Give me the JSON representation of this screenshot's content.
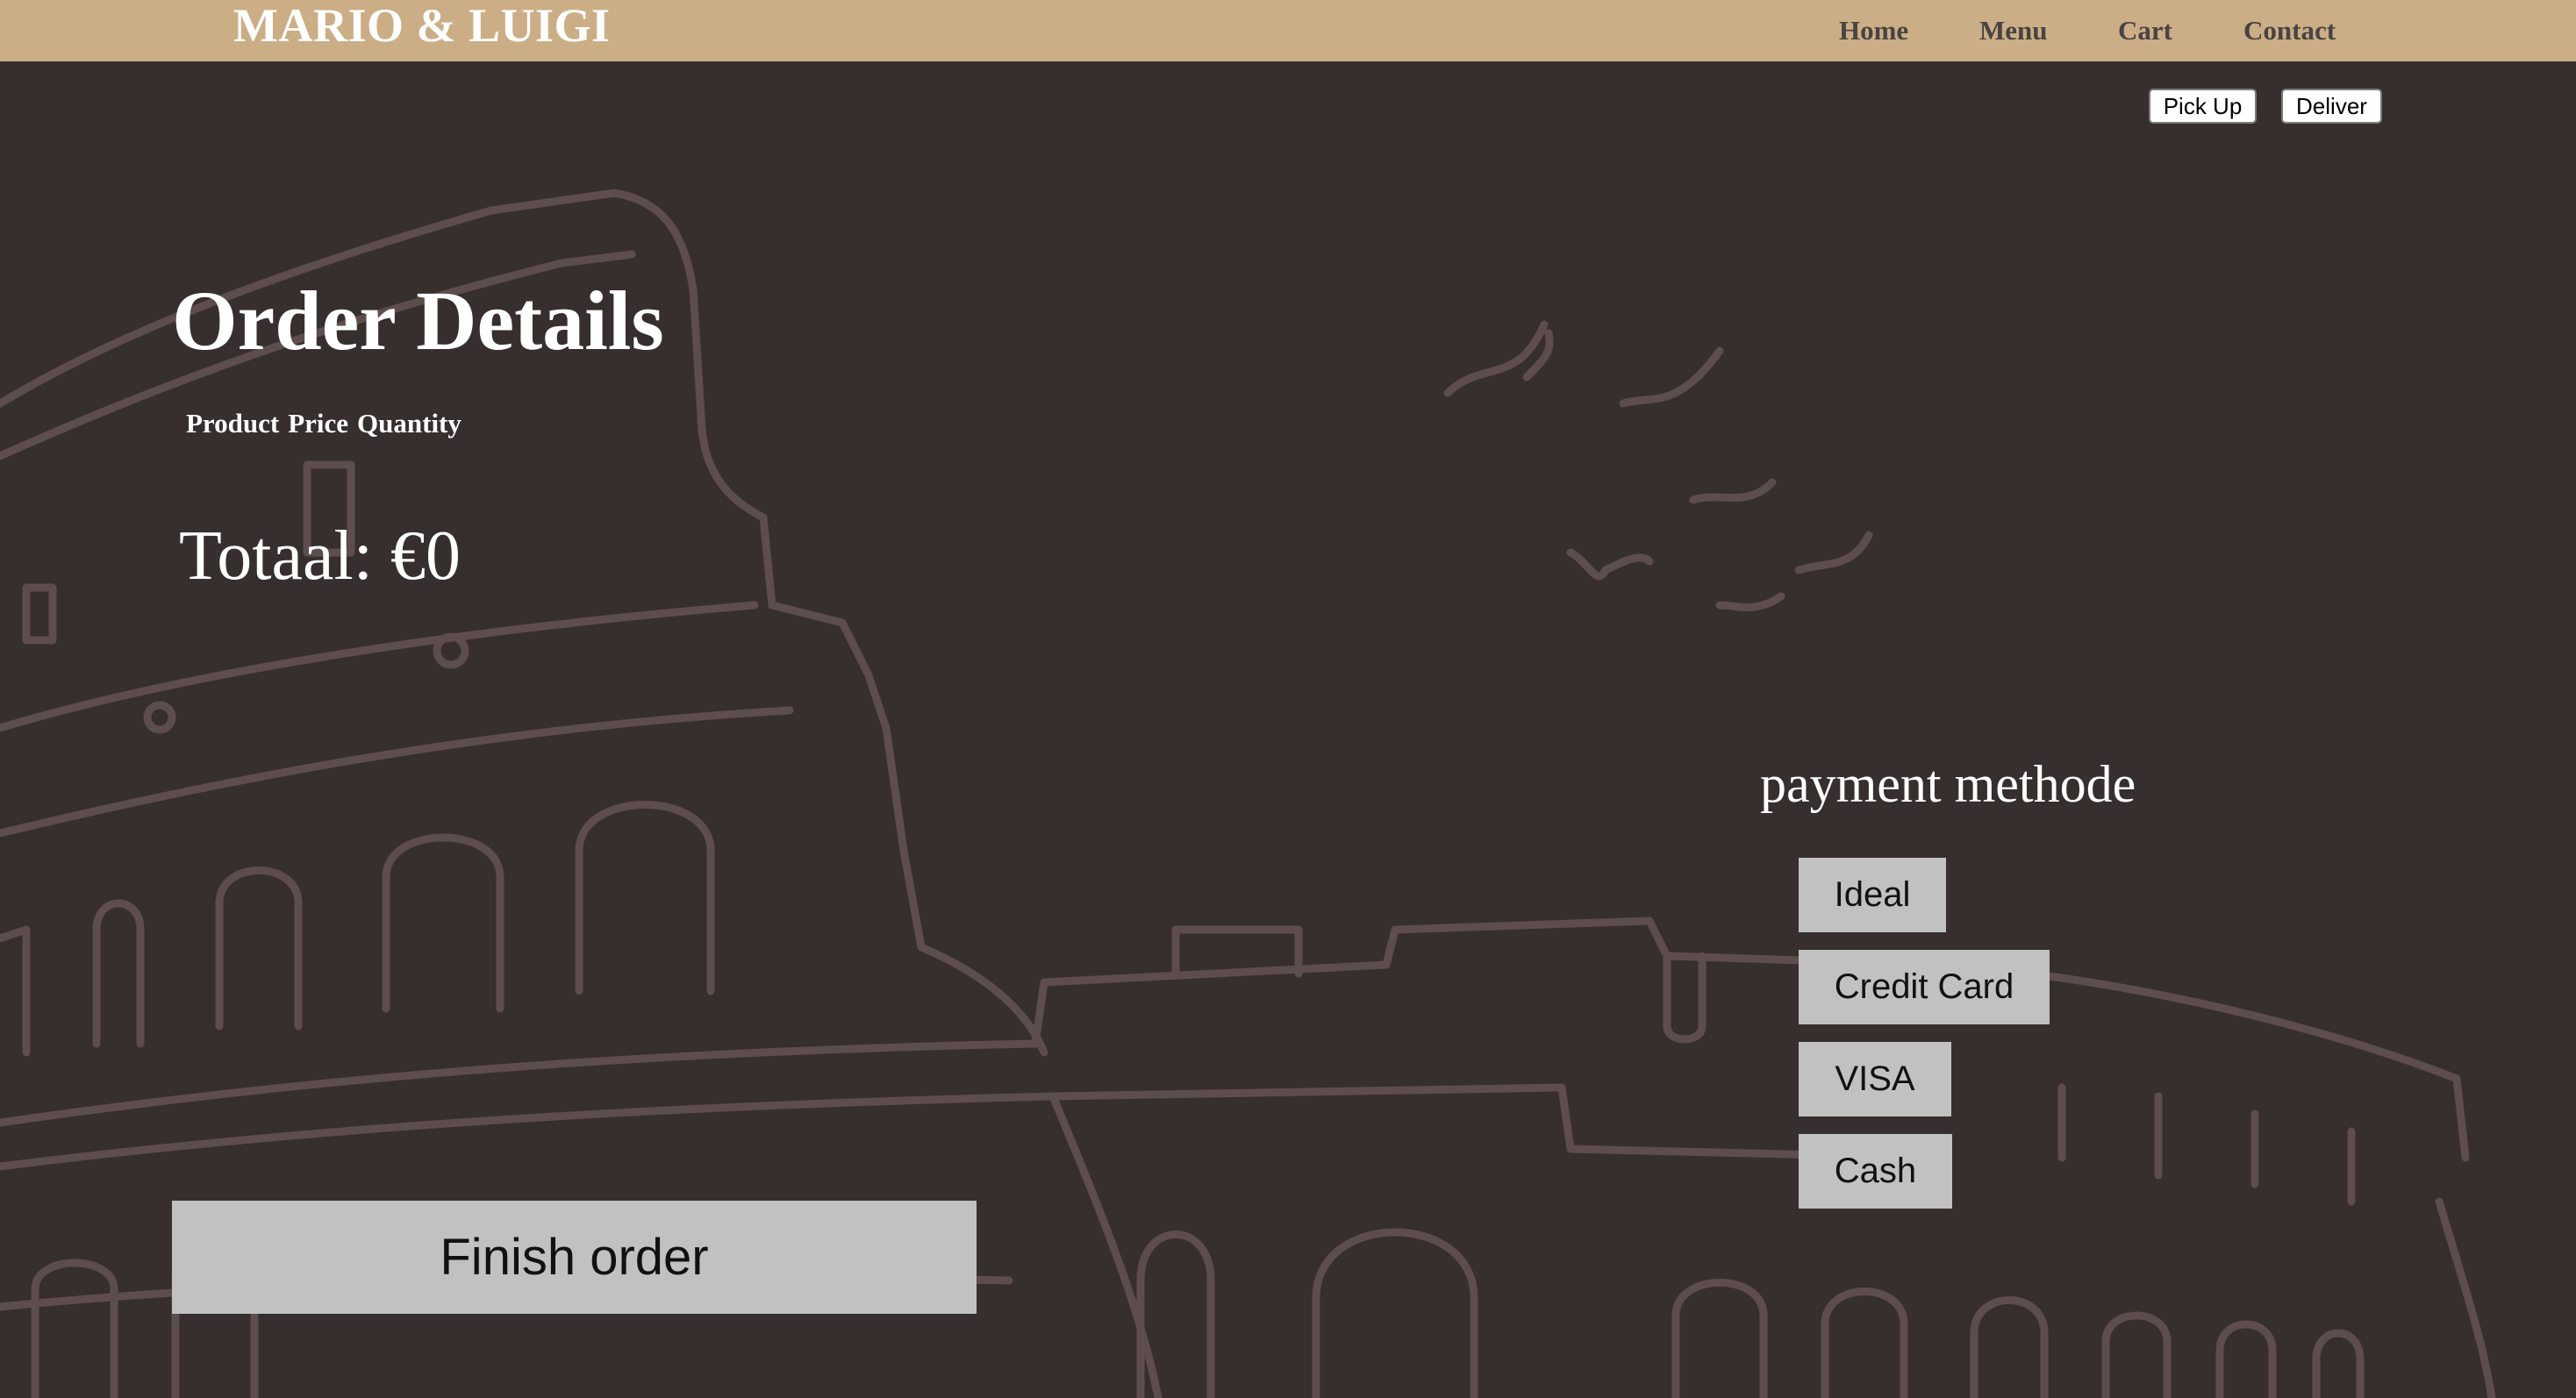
{
  "header": {
    "logo": "MARIO & LUIGI",
    "nav": {
      "home": "Home",
      "menu": "Menu",
      "cart": "Cart",
      "contact": "Contact"
    }
  },
  "delivery_options": {
    "pickup_label": "Pick Up",
    "deliver_label": "Deliver"
  },
  "order": {
    "title": "Order Details",
    "columns": [
      "Product",
      "Price",
      "Quantity"
    ],
    "total_text": "Totaal: €0"
  },
  "payment": {
    "title": "payment methode",
    "methods": [
      "Ideal",
      "Credit Card",
      "VISA",
      "Cash"
    ]
  },
  "finish_label": "Finish order",
  "colors": {
    "background": "#372e2e",
    "header": "#cbae86",
    "button": "#c1c1c1",
    "line_art": "#5e4d4d"
  },
  "icons": {
    "background": "colosseum-illustration"
  }
}
